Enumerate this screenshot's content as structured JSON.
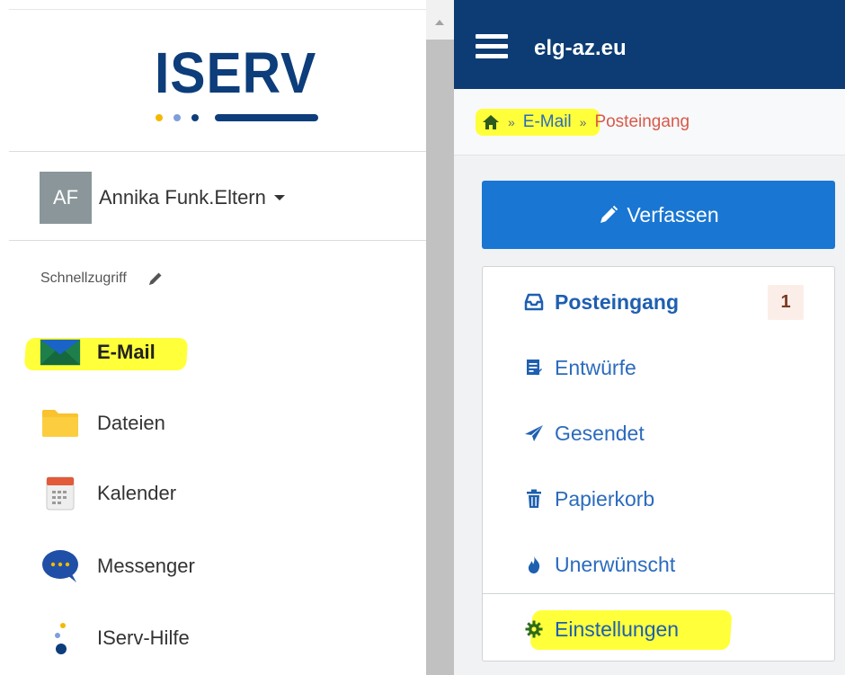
{
  "brand": {
    "logo_text": "ISERV",
    "colors": {
      "navy": "#0c3c73",
      "dot_yellow": "#f5b800",
      "dot_blue": "#6b8fd6"
    }
  },
  "user": {
    "initials": "AF",
    "name": "Annika Funk.Eltern"
  },
  "quick_access": {
    "label": "Schnellzugriff",
    "edit_icon": "pencil-icon"
  },
  "nav": [
    {
      "label": "E-Mail",
      "icon": "mail-icon",
      "active": true
    },
    {
      "label": "Dateien",
      "icon": "folder-icon"
    },
    {
      "label": "Kalender",
      "icon": "calendar-icon"
    },
    {
      "label": "Messenger",
      "icon": "chat-icon"
    },
    {
      "label": "IServ-Hilfe",
      "icon": "help-icon"
    }
  ],
  "topbar": {
    "title": "elg-az.eu",
    "menu_icon": "hamburger-icon"
  },
  "breadcrumb": {
    "home_icon": "home-icon",
    "sep": "»",
    "module": "E-Mail",
    "current": "Posteingang"
  },
  "compose": {
    "label": "Verfassen",
    "icon": "pencil-icon"
  },
  "folders": [
    {
      "label": "Posteingang",
      "icon": "inbox-icon",
      "badge": "1",
      "active": true
    },
    {
      "label": "Entwürfe",
      "icon": "drafts-icon"
    },
    {
      "label": "Gesendet",
      "icon": "sent-icon"
    },
    {
      "label": "Papierkorb",
      "icon": "trash-icon"
    },
    {
      "label": "Unerwünscht",
      "icon": "spam-icon"
    }
  ],
  "settings": {
    "label": "Einstellungen",
    "icon": "gear-icon"
  }
}
